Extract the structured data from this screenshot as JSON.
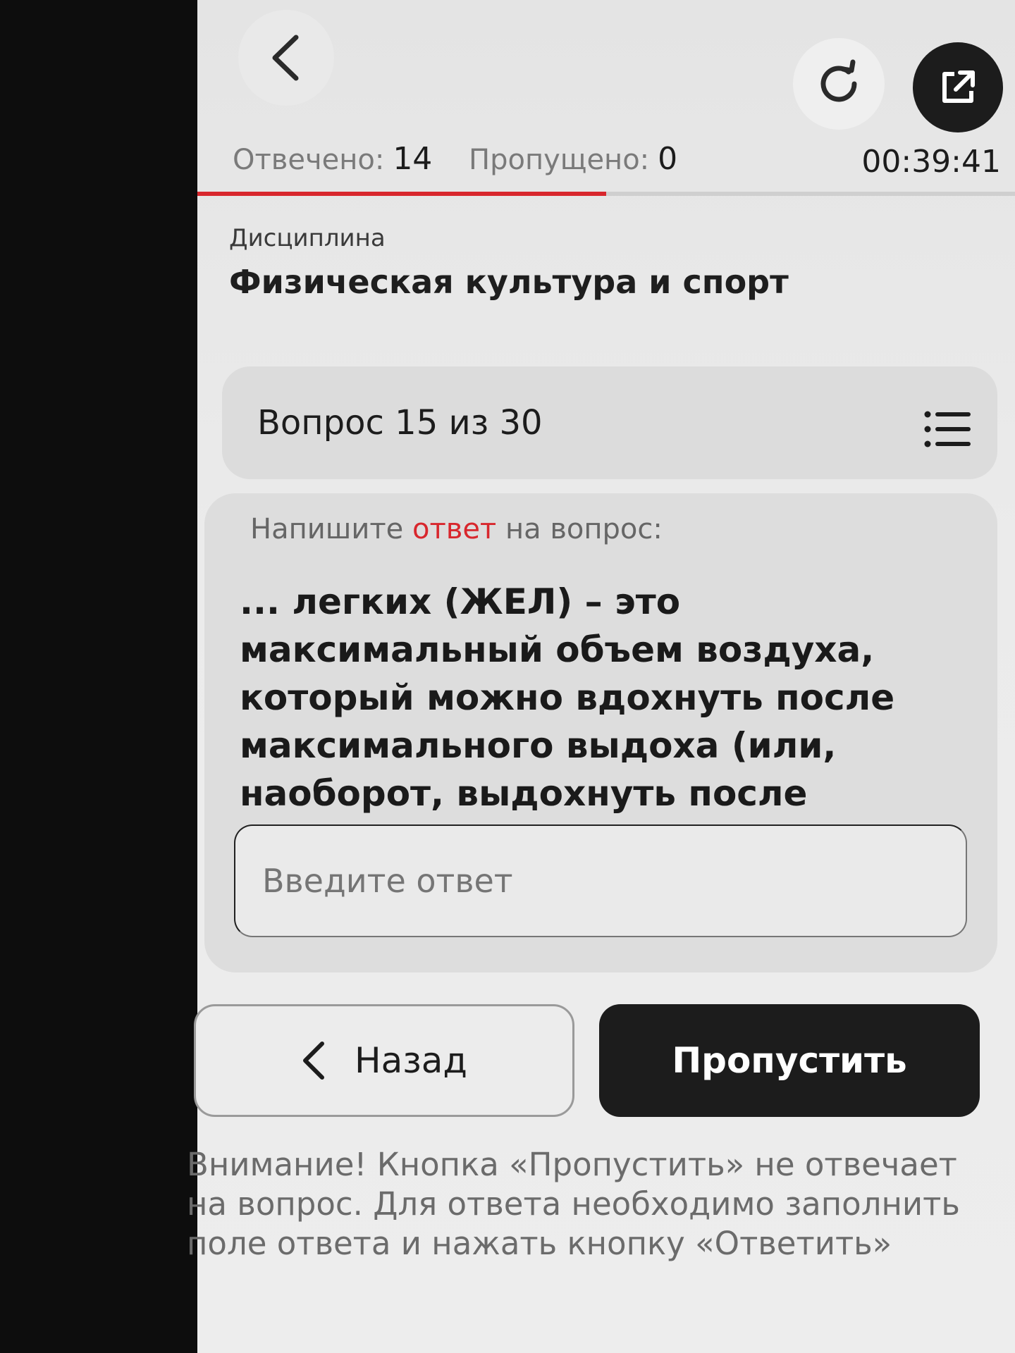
{
  "header": {
    "answered_label": "Отвечено:",
    "answered_count": "14",
    "skipped_label": "Пропущено:",
    "skipped_count": "0",
    "timer": "00:39:41",
    "progress_fraction": 0.5
  },
  "discipline": {
    "label": "Дисциплина",
    "name": "Физическая культура и спорт"
  },
  "question": {
    "counter": "Вопрос 15 из 30",
    "prompt_before": "Напишите ",
    "prompt_accent": "ответ",
    "prompt_after": " на вопрос:",
    "text": "... легких (ЖЕЛ) – это максимальный объем воздуха, который можно вдохнуть после максимального выдоха (или, наоборот, выдохнуть после максимального вдоха)"
  },
  "answer_input": {
    "value": "",
    "placeholder": "Введите ответ"
  },
  "buttons": {
    "back_label": "Назад",
    "skip_label": "Пропустить"
  },
  "warning": "Внимание! Кнопка «Пропустить» не отвечает на вопрос. Для ответа необходимо заполнить поле ответа и нажать кнопку «Ответить»",
  "colors": {
    "accent": "#d8272d",
    "primary_dark": "#1c1c1c"
  },
  "icons": [
    "chevron-left-icon",
    "refresh-icon",
    "external-link-icon",
    "list-icon"
  ]
}
